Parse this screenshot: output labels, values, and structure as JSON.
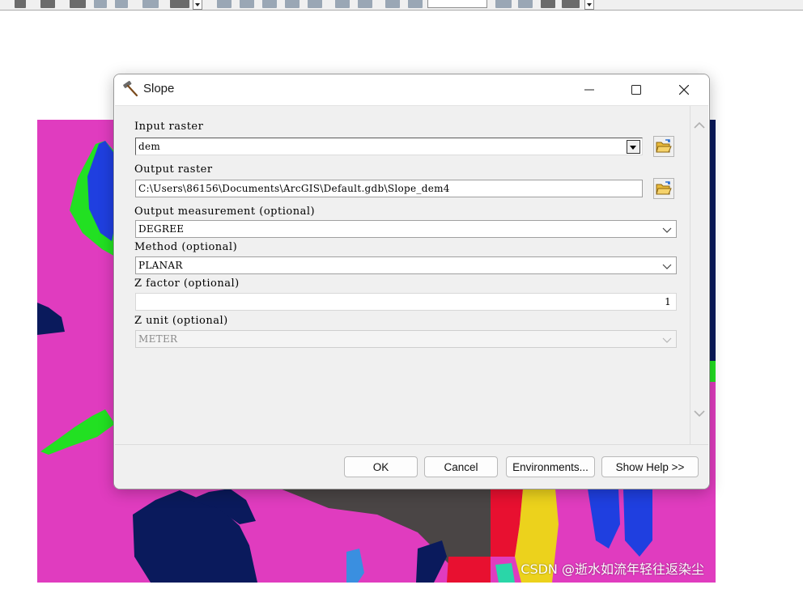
{
  "dialog": {
    "title": "Slope",
    "fields": {
      "input_raster": {
        "label": "Input raster",
        "value": "dem"
      },
      "output_raster": {
        "label": "Output raster",
        "value": "C:\\Users\\86156\\Documents\\ArcGIS\\Default.gdb\\Slope_dem4"
      },
      "output_measurement": {
        "label": "Output measurement (optional)",
        "value": "DEGREE"
      },
      "method": {
        "label": "Method (optional)",
        "value": "PLANAR"
      },
      "z_factor": {
        "label": "Z factor (optional)",
        "value": "1"
      },
      "z_unit": {
        "label": "Z unit (optional)",
        "value": "METER"
      }
    },
    "buttons": {
      "ok": "OK",
      "cancel": "Cancel",
      "environments": "Environments...",
      "show_help": "Show Help >>"
    }
  },
  "watermark": "CSDN @逝水如流年轻往返染尘",
  "colors": {
    "map_magenta": "#e03cbf",
    "map_navy": "#0a1a5c",
    "map_blue": "#1f3fe0",
    "map_green": "#22e022",
    "map_gray": "#4a4545",
    "map_red": "#e81030",
    "map_yellow": "#ecd21c",
    "map_teal": "#2ad6a8",
    "map_lightblue": "#3a8fe0"
  },
  "icons": [
    "hammer-icon",
    "minimize-icon",
    "maximize-icon",
    "close-icon",
    "folder-open-icon",
    "chevron-down-icon",
    "scroll-up-icon",
    "scroll-down-icon"
  ]
}
